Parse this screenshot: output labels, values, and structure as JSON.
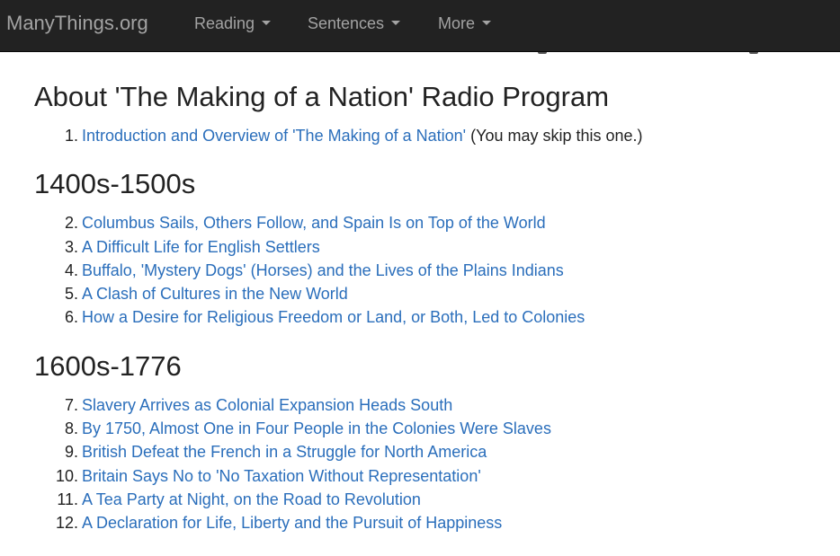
{
  "navbar": {
    "brand": "ManyThings.org",
    "items": [
      {
        "label": "Reading"
      },
      {
        "label": "Sentences"
      },
      {
        "label": "More"
      }
    ]
  },
  "sections": [
    {
      "heading": "About 'The Making of a Nation' Radio Program",
      "items": [
        {
          "num": "1.",
          "link": "Introduction and Overview of 'The Making of a Nation'",
          "note": " (You may skip this one.)"
        }
      ]
    },
    {
      "heading": "1400s-1500s",
      "items": [
        {
          "num": "2.",
          "link": "Columbus Sails, Others Follow, and Spain Is on Top of the World"
        },
        {
          "num": "3.",
          "link": "A Difficult Life for English Settlers"
        },
        {
          "num": "4.",
          "link": "Buffalo, 'Mystery Dogs' (Horses) and the Lives of the Plains Indians"
        },
        {
          "num": "5.",
          "link": "A Clash of Cultures in the New World"
        },
        {
          "num": "6.",
          "link": "How a Desire for Religious Freedom or Land, or Both, Led to Colonies"
        }
      ]
    },
    {
      "heading": "1600s-1776",
      "items": [
        {
          "num": "7.",
          "link": "Slavery Arrives as Colonial Expansion Heads South"
        },
        {
          "num": "8.",
          "link": "By 1750, Almost One in Four People in the Colonies Were Slaves"
        },
        {
          "num": "9.",
          "link": "British Defeat the French in a Struggle for North America"
        },
        {
          "num": "10.",
          "link": "Britain Says No to 'No Taxation Without Representation'"
        },
        {
          "num": "11.",
          "link": "A Tea Party at Night, on the Road to Revolution"
        },
        {
          "num": "12.",
          "link": "A Declaration for Life, Liberty and the Pursuit of Happiness"
        }
      ]
    }
  ],
  "colors": {
    "navbar_bg": "#222222",
    "nav_text": "#a3a3a3",
    "link": "#2a6ebb",
    "text": "#222222"
  }
}
